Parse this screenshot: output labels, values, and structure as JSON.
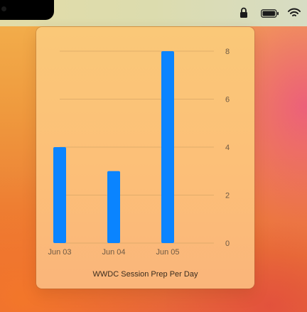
{
  "colors": {
    "bar": "#0a84ff",
    "grid": "#d9a766",
    "axis_label": "#6f5a44",
    "menubar": "#dcdcae",
    "panel": "#fcbf78"
  },
  "status_icons": [
    "lock-icon",
    "battery-icon",
    "wifi-icon"
  ],
  "chart_data": {
    "type": "bar",
    "title": "WWDC Session Prep Per Day",
    "categories": [
      "Jun 03",
      "Jun 04",
      "Jun 05"
    ],
    "values": [
      4,
      3,
      8
    ],
    "ylim": [
      0,
      8
    ],
    "yticks": [
      0,
      2,
      4,
      6,
      8
    ],
    "grid": true,
    "y_axis_position": "right"
  }
}
